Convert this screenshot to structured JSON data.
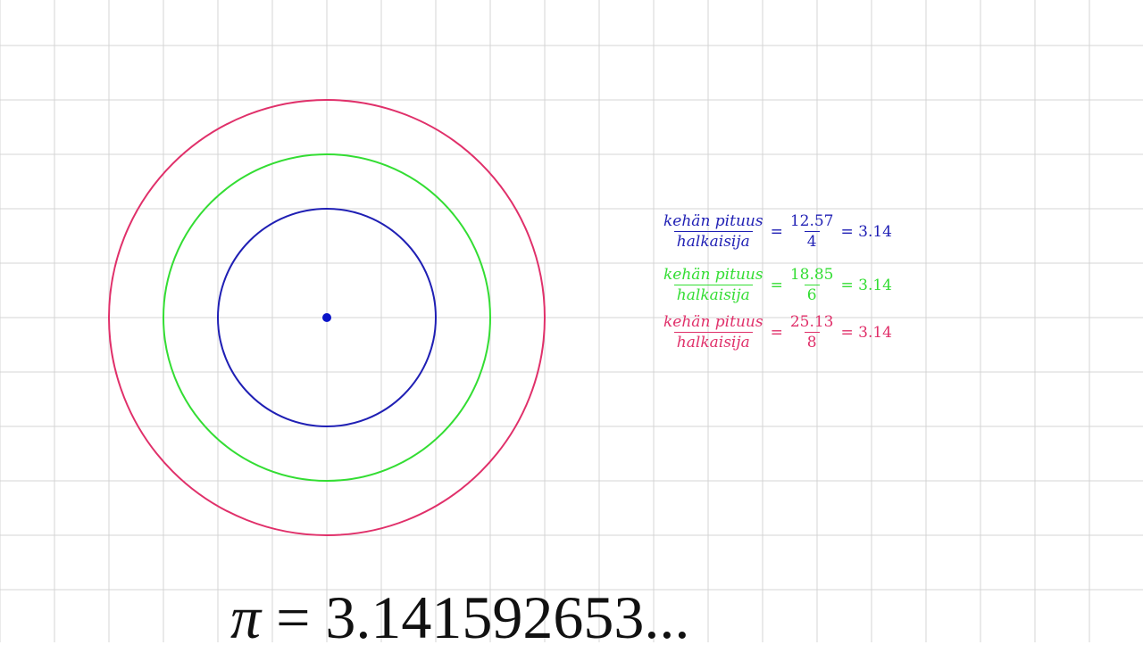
{
  "colors": {
    "background": "#ffffff",
    "grid": "#d4d4d4",
    "blue": "#1f1fb4",
    "green": "#33dd33",
    "red": "#e0306a",
    "center_point": "#0a14c8"
  },
  "circles": [
    {
      "name": "small",
      "color": "blue",
      "diameter": 4
    },
    {
      "name": "medium",
      "color": "green",
      "diameter": 6
    },
    {
      "name": "large",
      "color": "red",
      "diameter": 8
    }
  ],
  "formulas": [
    {
      "numerator_label": "kehän pituus",
      "denominator_label": "halkaisija",
      "equals1": "=",
      "value_num": "12.57",
      "value_den": "4",
      "result": "= 3.14",
      "color": "blue"
    },
    {
      "numerator_label": "kehän pituus",
      "denominator_label": "halkaisija",
      "equals1": "=",
      "value_num": "18.85",
      "value_den": "6",
      "result": "= 3.14",
      "color": "green"
    },
    {
      "numerator_label": "kehän pituus",
      "denominator_label": "halkaisija",
      "equals1": "=",
      "value_num": "25.13",
      "value_den": "8",
      "result": "= 3.14",
      "color": "red"
    }
  ],
  "pi_statement": {
    "symbol": "π",
    "rest": " = 3.141592653..."
  }
}
